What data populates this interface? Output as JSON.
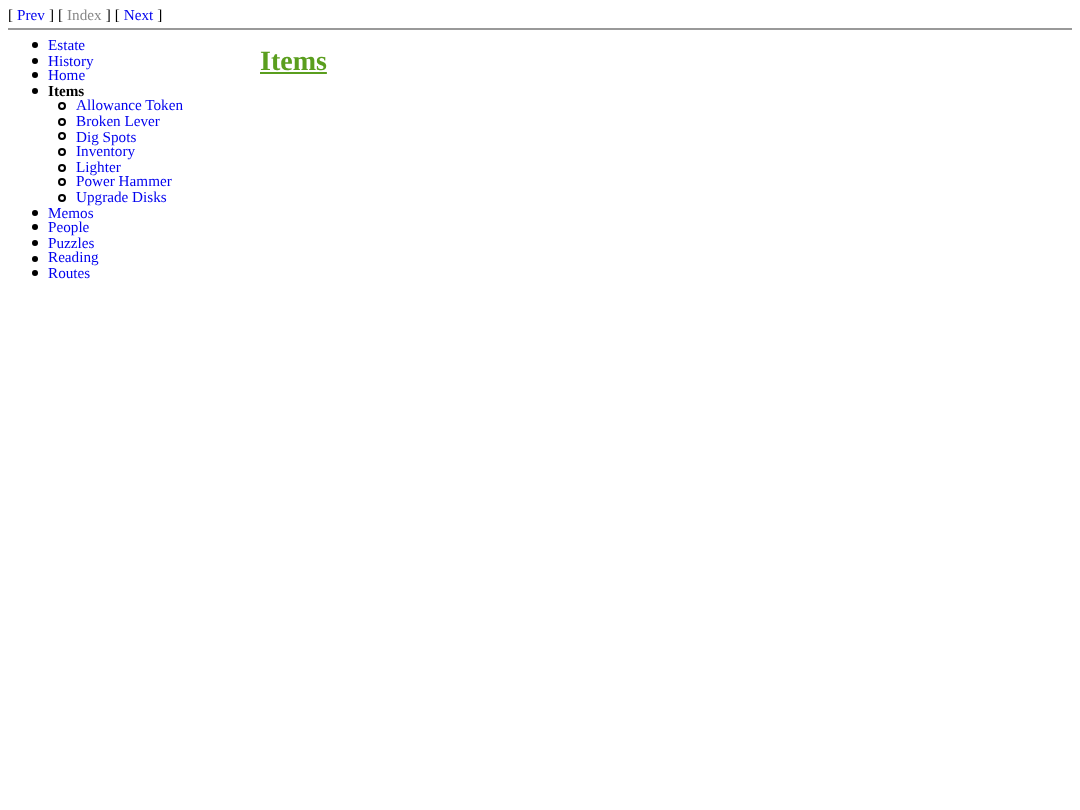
{
  "nav": [
    {
      "open": "[",
      "label": "Prev",
      "close": "]",
      "disabled": false
    },
    {
      "open": "[",
      "label": "Index",
      "close": "]",
      "disabled": true
    },
    {
      "open": "[",
      "label": "Next",
      "close": "]",
      "disabled": false
    }
  ],
  "sidebar": {
    "items": [
      {
        "label": "Estate",
        "selected": false
      },
      {
        "label": "History",
        "selected": false
      },
      {
        "label": "Home",
        "selected": false
      },
      {
        "label": "Items",
        "selected": true,
        "children": [
          {
            "label": "Allowance Token",
            "selected": false
          },
          {
            "label": "Broken Lever",
            "selected": false
          },
          {
            "label": "Dig Spots",
            "selected": false
          },
          {
            "label": "Inventory",
            "selected": false
          },
          {
            "label": "Lighter",
            "selected": false
          },
          {
            "label": "Power Hammer",
            "selected": false
          },
          {
            "label": "Upgrade Disks",
            "selected": false
          }
        ]
      },
      {
        "label": "Memos",
        "selected": false
      },
      {
        "label": "People",
        "selected": false
      },
      {
        "label": "Puzzles",
        "selected": false
      },
      {
        "label": "Reading",
        "selected": false
      },
      {
        "label": "Routes",
        "selected": false
      }
    ]
  },
  "heading": "Items"
}
